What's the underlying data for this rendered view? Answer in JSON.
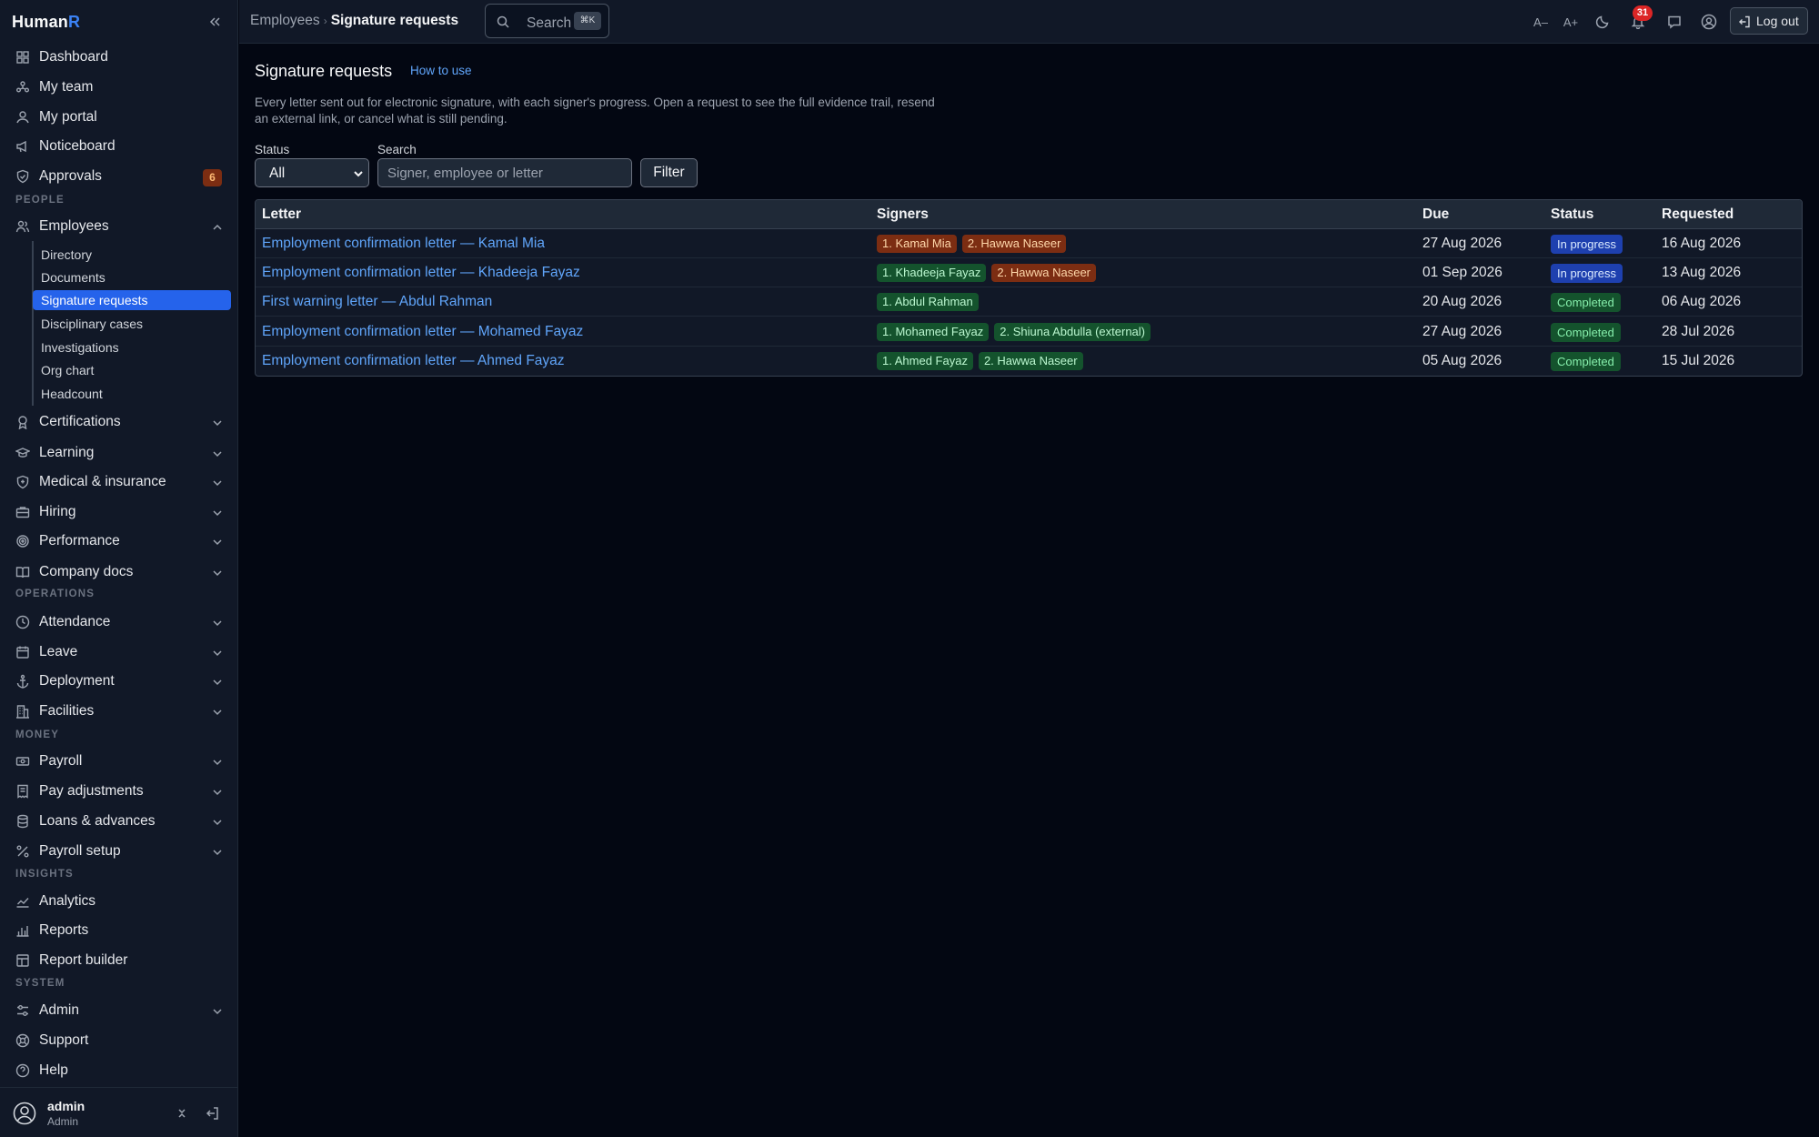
{
  "app": {
    "name_prefix": "Human",
    "name_suffix": "R"
  },
  "sidebar": {
    "items": [
      {
        "label": "Dashboard",
        "icon": "grid-icon"
      },
      {
        "label": "My team",
        "icon": "team-icon"
      },
      {
        "label": "My portal",
        "icon": "user-icon"
      },
      {
        "label": "Noticeboard",
        "icon": "megaphone-icon"
      },
      {
        "label": "Approvals",
        "icon": "shield-check-icon",
        "badge": "6"
      }
    ],
    "sections": {
      "people": "PEOPLE",
      "operations": "OPERATIONS",
      "money": "MONEY",
      "insights": "INSIGHTS",
      "system": "SYSTEM"
    },
    "employees": {
      "label": "Employees",
      "sub": [
        "Directory",
        "Documents",
        "Signature requests",
        "Disciplinary cases",
        "Investigations",
        "Org chart",
        "Headcount"
      ]
    },
    "people_items": [
      "Certifications",
      "Learning",
      "Medical & insurance",
      "Hiring",
      "Performance",
      "Company docs"
    ],
    "operations_items": [
      "Attendance",
      "Leave",
      "Deployment",
      "Facilities"
    ],
    "money_items": [
      "Payroll",
      "Pay adjustments",
      "Loans & advances",
      "Payroll setup"
    ],
    "insights_items": [
      "Analytics",
      "Reports",
      "Report builder"
    ],
    "system_items": [
      "Admin",
      "Support",
      "Help"
    ],
    "user": {
      "name": "admin",
      "role": "Admin"
    }
  },
  "topbar": {
    "crumb_parent": "Employees",
    "crumb_current": "Signature requests",
    "search_label": "Search",
    "search_kbd": "⌘K",
    "font_smaller": "A–",
    "font_larger": "A+",
    "notifications": "31",
    "logout": "Log out"
  },
  "page": {
    "title": "Signature requests",
    "how_to": "How to use",
    "description": "Every letter sent out for electronic signature, with each signer's progress. Open a request to see the full evidence trail, resend an external link, or cancel what is still pending.",
    "filters": {
      "status_label": "Status",
      "status_value": "All",
      "search_label": "Search",
      "search_placeholder": "Signer, employee or letter",
      "filter_button": "Filter"
    }
  },
  "table": {
    "headers": [
      "Letter",
      "Signers",
      "Due",
      "Status",
      "Requested"
    ],
    "rows": [
      {
        "letter": "Employment confirmation letter — Kamal Mia",
        "signers": [
          {
            "name": "1. Kamal Mia",
            "state": "orange"
          },
          {
            "name": "2. Hawwa Naseer",
            "state": "orange"
          }
        ],
        "due": "27 Aug 2026",
        "status": "In progress",
        "status_kind": "prog",
        "requested": "16 Aug 2026"
      },
      {
        "letter": "Employment confirmation letter — Khadeeja Fayaz",
        "signers": [
          {
            "name": "1. Khadeeja Fayaz",
            "state": "green"
          },
          {
            "name": "2. Hawwa Naseer",
            "state": "orange"
          }
        ],
        "due": "01 Sep 2026",
        "status": "In progress",
        "status_kind": "prog",
        "requested": "13 Aug 2026"
      },
      {
        "letter": "First warning letter — Abdul Rahman",
        "signers": [
          {
            "name": "1. Abdul Rahman",
            "state": "green"
          }
        ],
        "due": "20 Aug 2026",
        "status": "Completed",
        "status_kind": "done",
        "requested": "06 Aug 2026"
      },
      {
        "letter": "Employment confirmation letter — Mohamed Fayaz",
        "signers": [
          {
            "name": "1. Mohamed Fayaz",
            "state": "green"
          },
          {
            "name": "2. Shiuna Abdulla (external)",
            "state": "green"
          }
        ],
        "due": "27 Aug 2026",
        "status": "Completed",
        "status_kind": "done",
        "requested": "28 Jul 2026"
      },
      {
        "letter": "Employment confirmation letter — Ahmed Fayaz",
        "signers": [
          {
            "name": "1. Ahmed Fayaz",
            "state": "green"
          },
          {
            "name": "2. Hawwa Naseer",
            "state": "green"
          }
        ],
        "due": "05 Aug 2026",
        "status": "Completed",
        "status_kind": "done",
        "requested": "15 Jul 2026"
      }
    ]
  }
}
